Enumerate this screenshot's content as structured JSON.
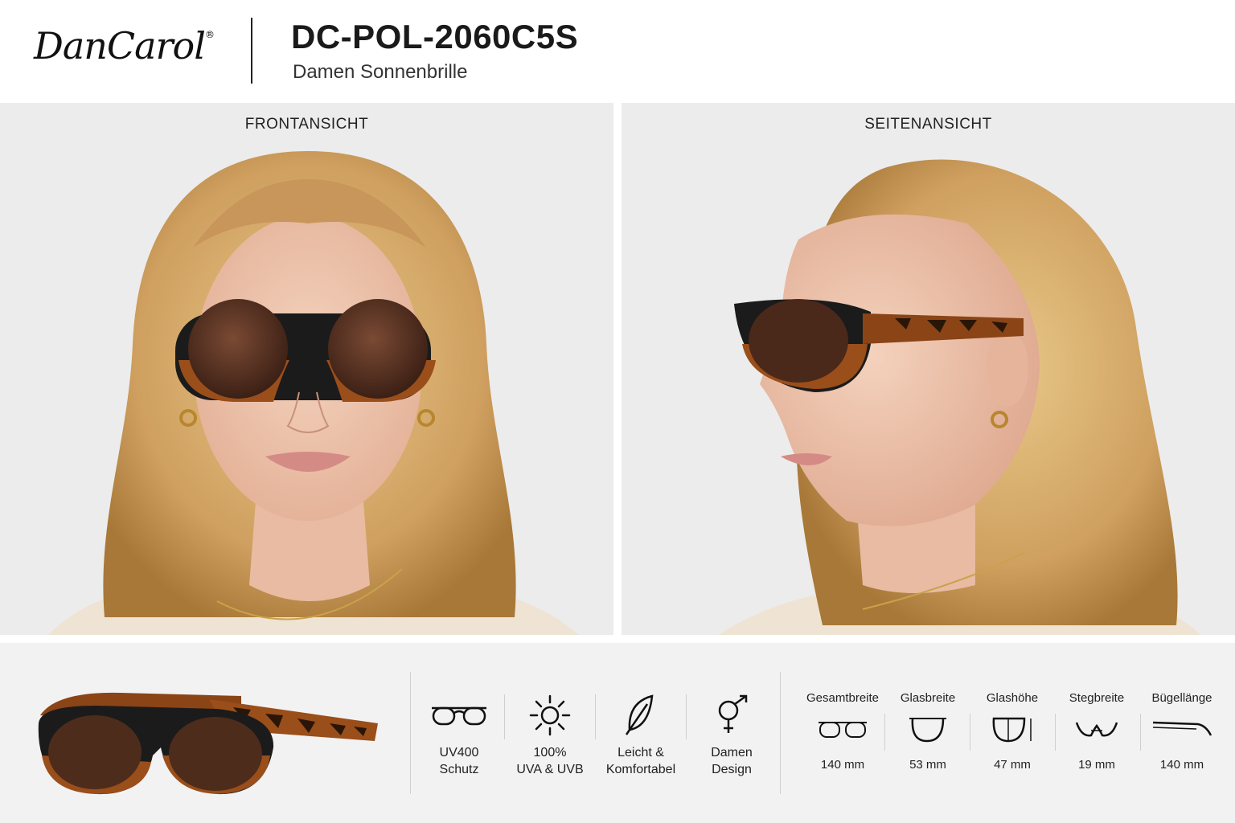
{
  "header": {
    "logo": "DanCarol",
    "logo_mark": "®",
    "model": "DC-POL-2060C5S",
    "subtitle": "Damen Sonnenbrille"
  },
  "panels": {
    "front_label": "FRONTANSICHT",
    "side_label": "SEITENANSICHT"
  },
  "features": [
    {
      "icon": "glasses-icon",
      "line1": "UV400",
      "line2": "Schutz"
    },
    {
      "icon": "sun-icon",
      "line1": "100%",
      "line2": "UVA & UVB"
    },
    {
      "icon": "feather-icon",
      "line1": "Leicht &",
      "line2": "Komfortabel"
    },
    {
      "icon": "female-male-icon",
      "line1": "Damen",
      "line2": "Design"
    }
  ],
  "dimensions": [
    {
      "icon": "overall-width-icon",
      "label": "Gesamtbreite",
      "value": "140 mm"
    },
    {
      "icon": "lens-width-icon",
      "label": "Glasbreite",
      "value": "53 mm"
    },
    {
      "icon": "lens-height-icon",
      "label": "Glashöhe",
      "value": "47 mm"
    },
    {
      "icon": "bridge-width-icon",
      "label": "Stegbreite",
      "value": "19 mm"
    },
    {
      "icon": "temple-length-icon",
      "label": "Bügellänge",
      "value": "140 mm"
    }
  ],
  "colors": {
    "panel_bg": "#ececec",
    "frame_black": "#1b1b1b",
    "tortoise": "#a0541c",
    "lens_brown": "#5a3322",
    "hair_blonde": "#d9b070"
  }
}
